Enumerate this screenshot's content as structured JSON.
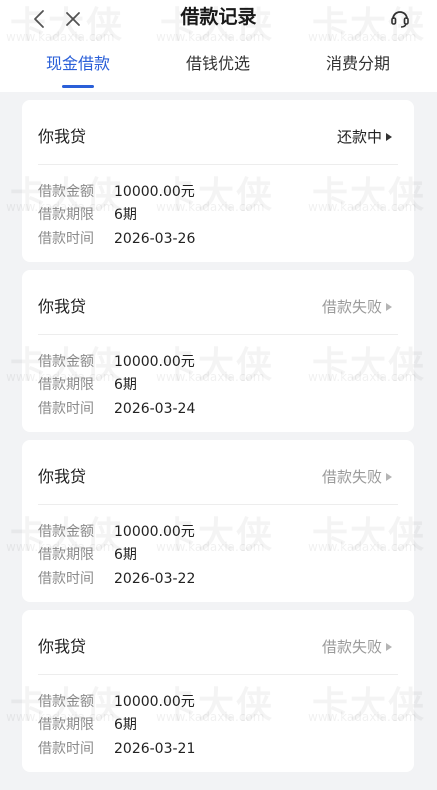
{
  "header": {
    "title": "借款记录",
    "back_icon": "chevron-left-icon",
    "close_icon": "close-icon",
    "service_icon": "headset-icon"
  },
  "tabs": [
    {
      "label": "现金借款",
      "active": true
    },
    {
      "label": "借钱优选",
      "active": false
    },
    {
      "label": "消费分期",
      "active": false
    }
  ],
  "records": [
    {
      "product": "你我贷",
      "status": "还款中",
      "status_type": "ok",
      "amount_label": "借款金额",
      "amount": "10000.00元",
      "term_label": "借款期限",
      "term": "6期",
      "date_label": "借款时间",
      "date": "2026-03-26"
    },
    {
      "product": "你我贷",
      "status": "借款失败",
      "status_type": "fail",
      "amount_label": "借款金额",
      "amount": "10000.00元",
      "term_label": "借款期限",
      "term": "6期",
      "date_label": "借款时间",
      "date": "2026-03-24"
    },
    {
      "product": "你我贷",
      "status": "借款失败",
      "status_type": "fail",
      "amount_label": "借款金额",
      "amount": "10000.00元",
      "term_label": "借款期限",
      "term": "6期",
      "date_label": "借款时间",
      "date": "2026-03-22"
    },
    {
      "product": "你我贷",
      "status": "借款失败",
      "status_type": "fail",
      "amount_label": "借款金额",
      "amount": "10000.00元",
      "term_label": "借款期限",
      "term": "6期",
      "date_label": "借款时间",
      "date": "2026-03-21"
    }
  ],
  "watermark": {
    "brand": "卡大侠",
    "url": "www.kadaxia.com"
  },
  "colors": {
    "accent": "#2a5fd8",
    "background": "#f2f3f5",
    "muted_text": "#8c8c8c",
    "fail_text": "#9a9a9a"
  }
}
